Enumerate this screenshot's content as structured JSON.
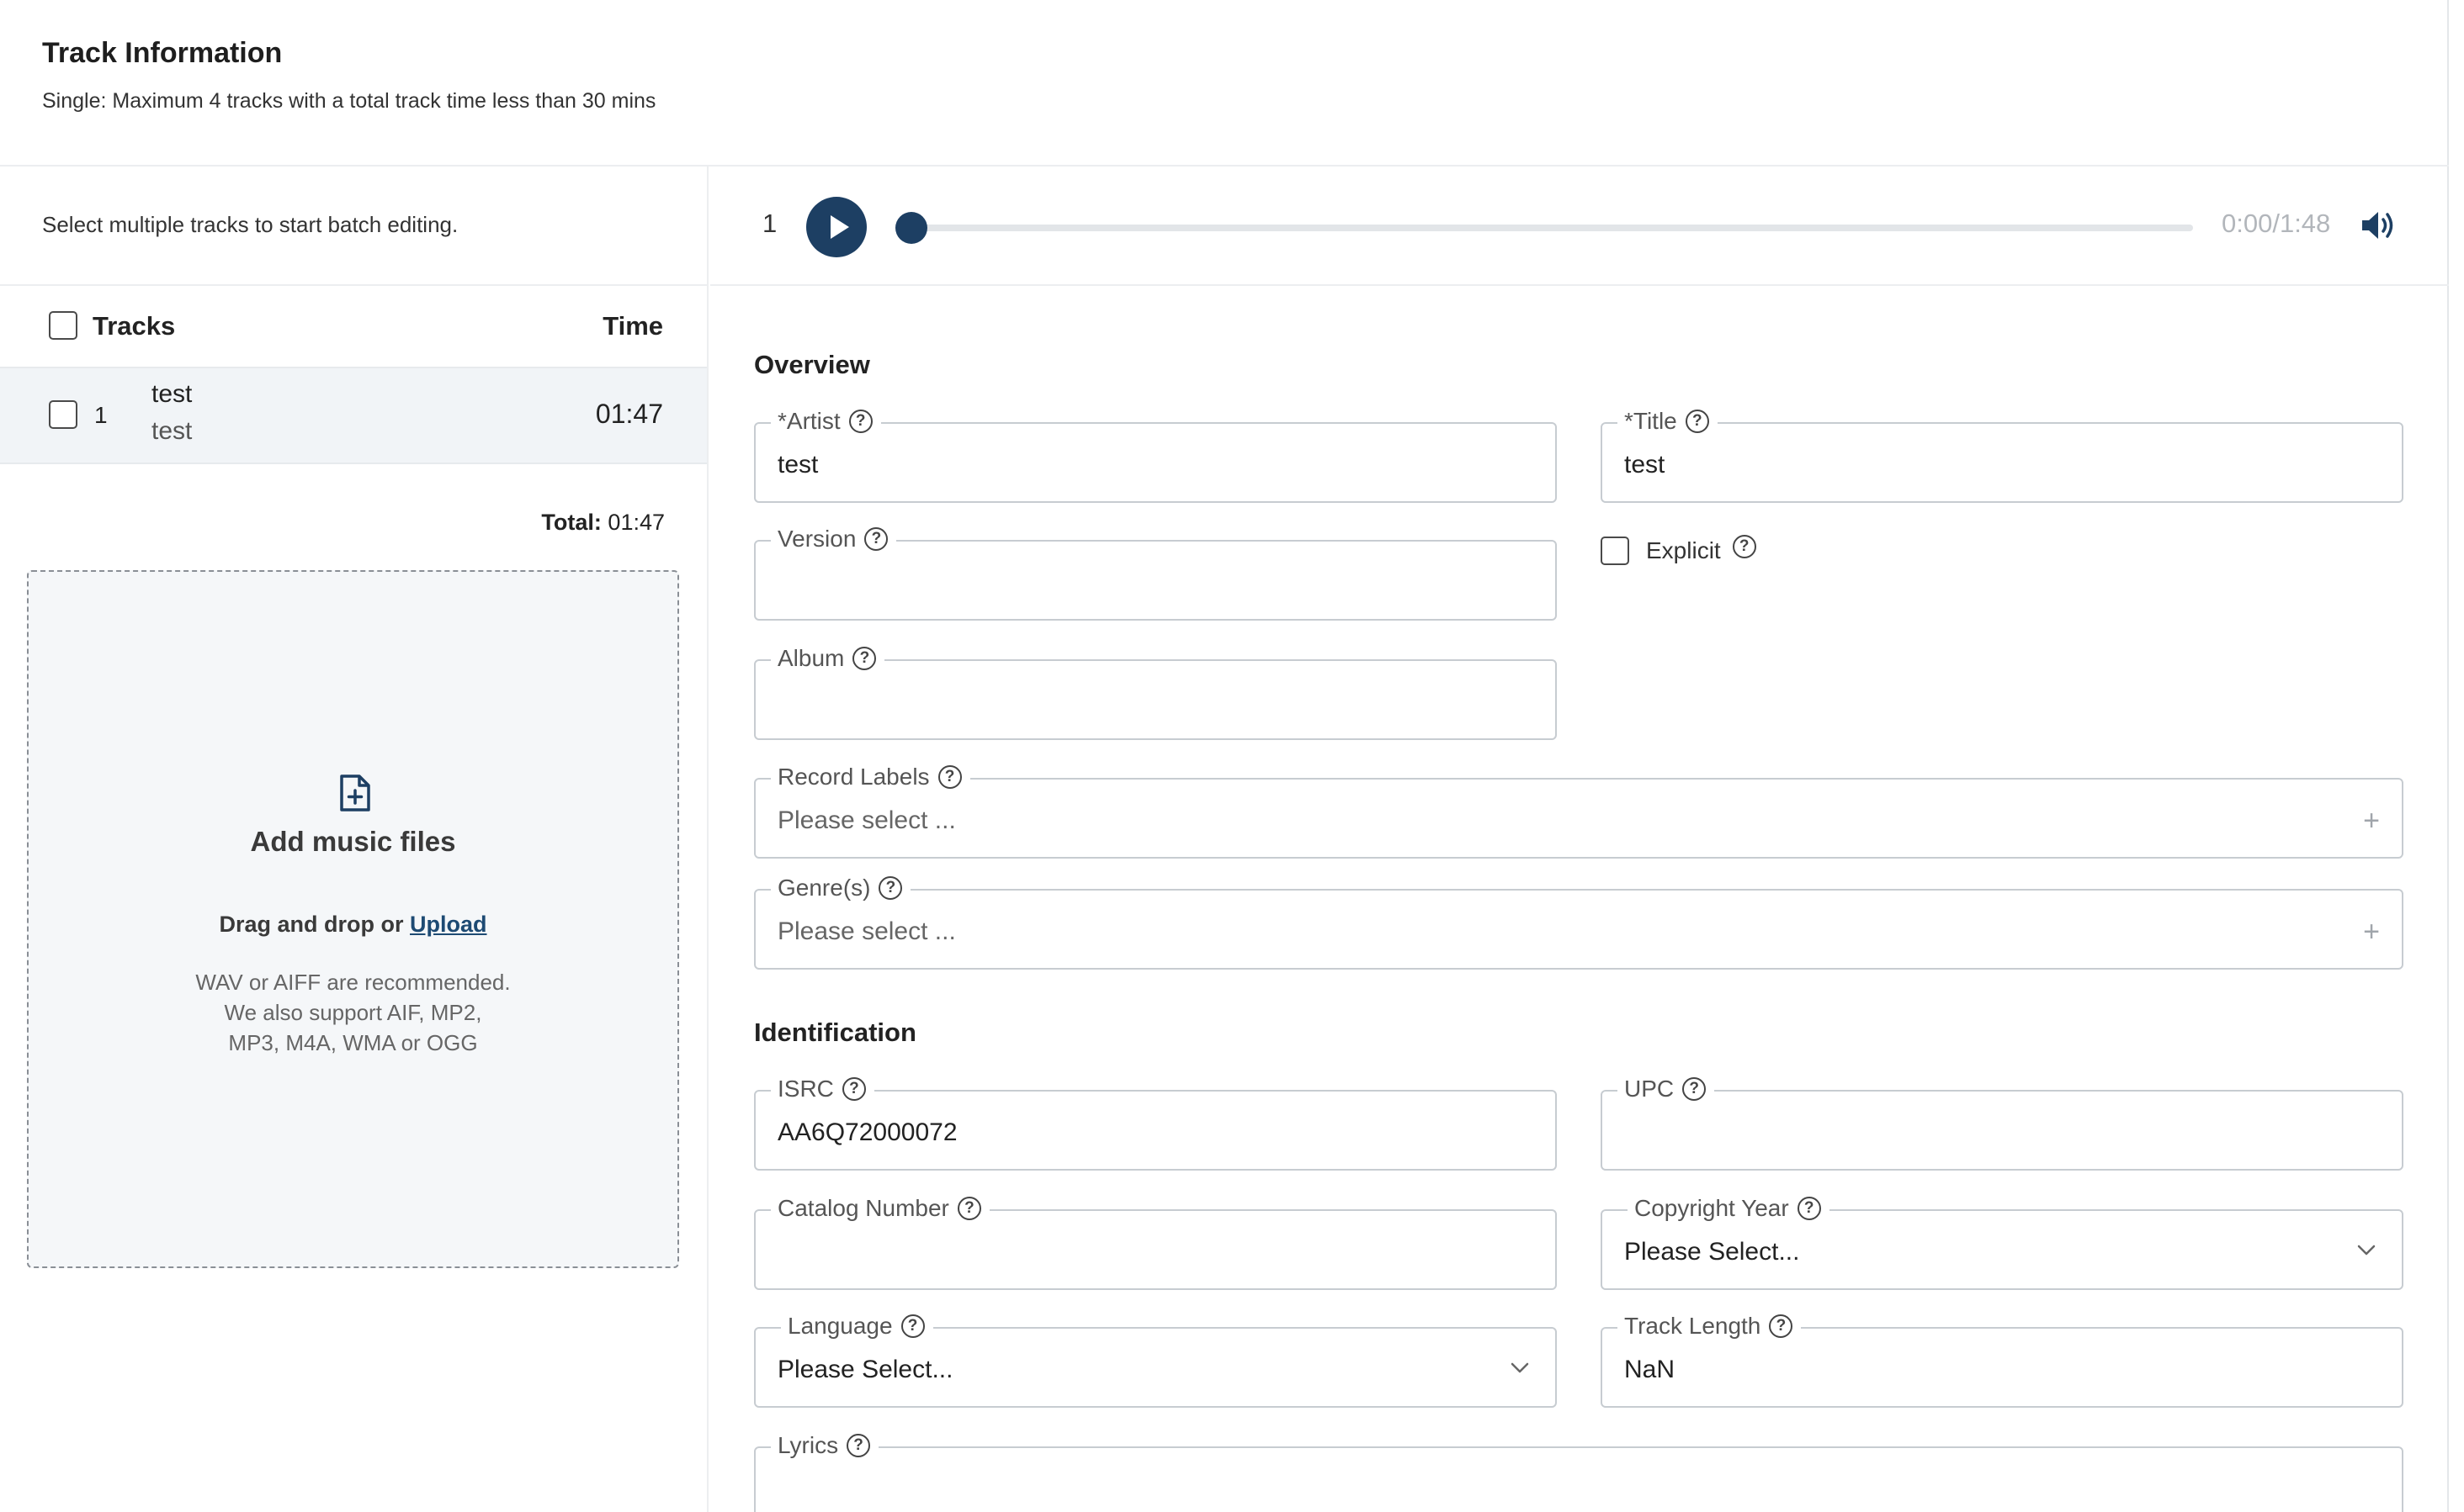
{
  "header": {
    "title": "Track Information",
    "subtitle": "Single: Maximum 4 tracks with a total track time less than 30 mins"
  },
  "left": {
    "batch_note": "Select multiple tracks to start batch editing.",
    "tracks_label": "Tracks",
    "time_label": "Time",
    "tracks": [
      {
        "number": "1",
        "title": "test",
        "artist": "test",
        "duration": "01:47"
      }
    ],
    "total_label": "Total:",
    "total_value": "01:47",
    "dropzone": {
      "icon": "file-plus-icon",
      "title": "Add music files",
      "drag_text": "Drag and drop or",
      "upload_link": "Upload",
      "help_line1": "WAV or AIFF are recommended.",
      "help_line2": "We also support AIF, MP2,",
      "help_line3": "MP3, M4A, WMA or OGG"
    }
  },
  "player": {
    "track_index": "1",
    "time": "0:00/1:48",
    "progress": 0,
    "accent_color": "#1d3f63"
  },
  "overview": {
    "title": "Overview",
    "artist_label": "*Artist",
    "artist_value": "test",
    "title_label": "*Title",
    "title_value": "test",
    "version_label": "Version",
    "version_value": "",
    "explicit_label": "Explicit",
    "explicit_checked": false,
    "album_label": "Album",
    "album_value": "",
    "record_labels_label": "Record Labels",
    "record_labels_placeholder": "Please select ...",
    "genres_label": "Genre(s)",
    "genres_placeholder": "Please select ..."
  },
  "identification": {
    "title": "Identification",
    "isrc_label": "ISRC",
    "isrc_value": "AA6Q72000072",
    "upc_label": "UPC",
    "upc_value": "",
    "catalog_label": "Catalog Number",
    "catalog_value": "",
    "copyright_label": "Copyright Year",
    "copyright_value": "Please Select...",
    "language_label": "Language",
    "language_value": "Please Select...",
    "track_length_label": "Track Length",
    "track_length_value": "NaN",
    "lyrics_label": "Lyrics"
  },
  "help_glyph": "?",
  "plus_glyph": "+"
}
